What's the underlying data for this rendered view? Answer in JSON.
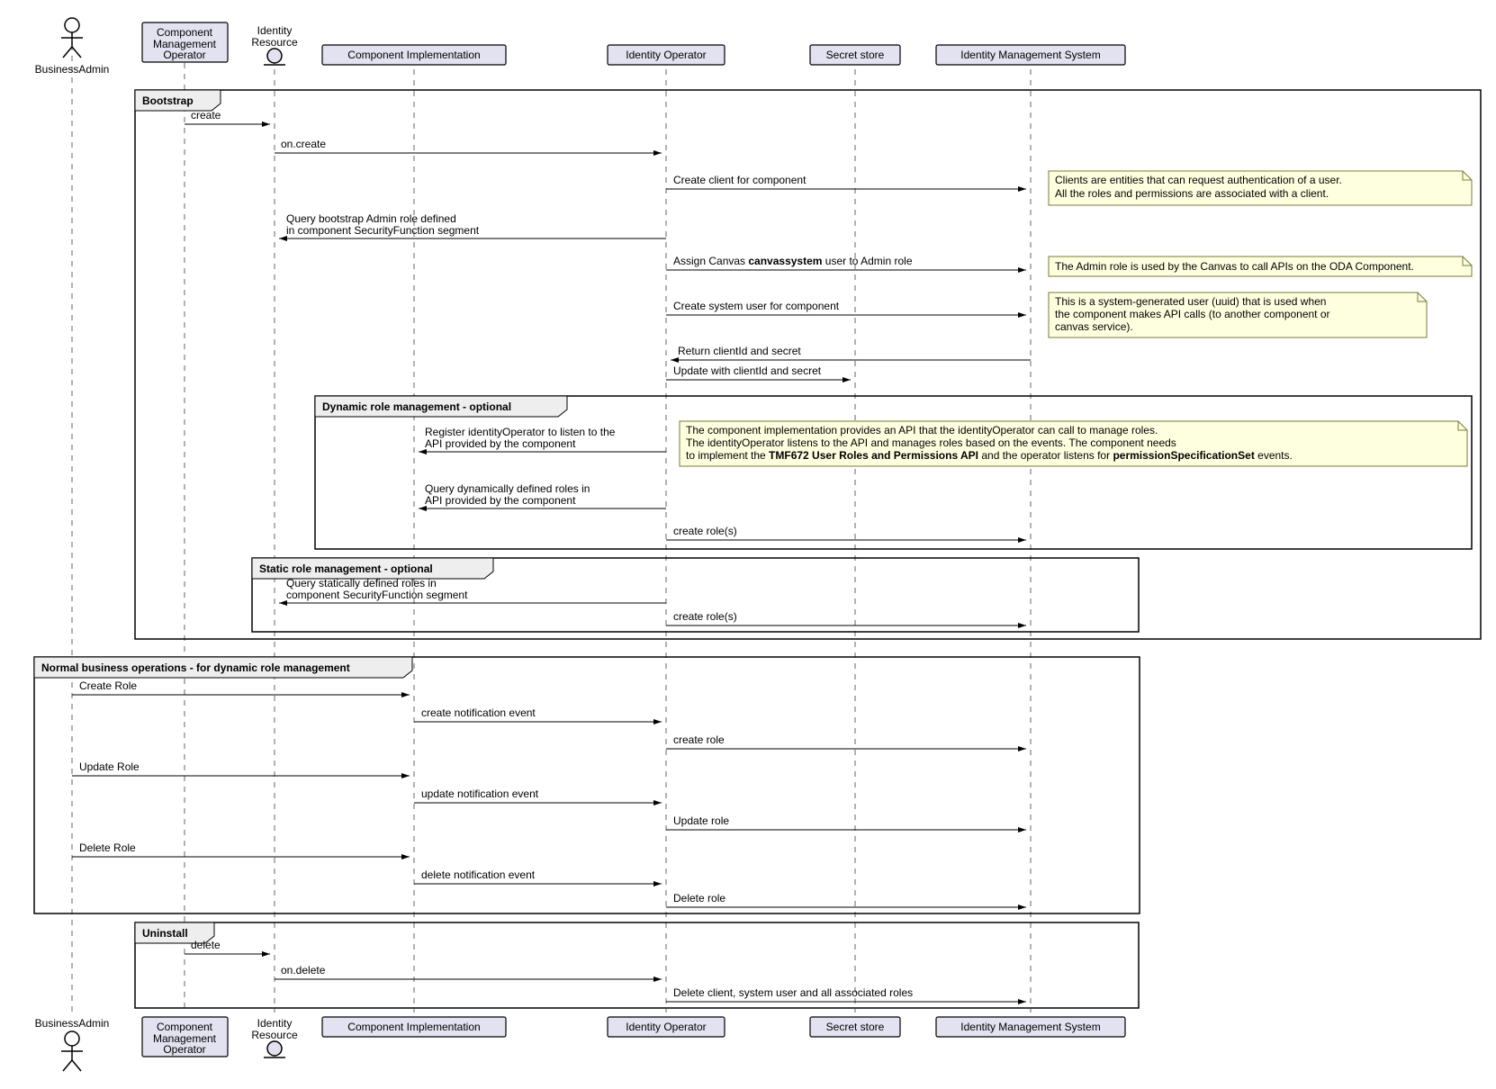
{
  "participants": {
    "businessAdmin": "BusinessAdmin",
    "componentMgmtOp1": "Component",
    "componentMgmtOp2": "Management",
    "componentMgmtOp3": "Operator",
    "identityResource1": "Identity",
    "identityResource2": "Resource",
    "componentImpl": "Component Implementation",
    "identityOperator": "Identity Operator",
    "secretStore": "Secret store",
    "ims": "Identity Management System"
  },
  "groups": {
    "bootstrap": "Bootstrap",
    "dynamicRole": "Dynamic role management - optional",
    "staticRole": "Static role management - optional",
    "normalOps": "Normal business operations - for dynamic role management",
    "uninstall": "Uninstall"
  },
  "messages": {
    "create": "create",
    "onCreate": "on.create",
    "createClient": "Create client for component",
    "queryBootstrap1": "Query bootstrap Admin role defined",
    "queryBootstrap2": "in component SecurityFunction segment",
    "assignCanvas1": "Assign Canvas ",
    "assignCanvas2": "canvassystem",
    "assignCanvas3": " user to Admin role",
    "createSysUser": "Create system user for component",
    "returnClientId": "Return clientId and secret",
    "updateClientId": "Update with clientId and secret",
    "registerListen1": "Register identityOperator to listen to the",
    "registerListen2": "API provided by the component",
    "queryDyn1": "Query dynamically defined roles in",
    "queryDyn2": "API provided by the component",
    "createRoles": "create role(s)",
    "queryStatic1": "Query statically defined roles in",
    "queryStatic2": "component SecurityFunction segment",
    "createRoleMsg": "Create Role",
    "createNotif": "create notification event",
    "createRole": "create role",
    "updateRoleMsg": "Update Role",
    "updateNotif": "update notification event",
    "updateRole": "Update role",
    "deleteRoleMsg": "Delete Role",
    "deleteNotif": "delete notification event",
    "deleteRole": "Delete role",
    "delete": "delete",
    "onDelete": "on.delete",
    "deleteClient": "Delete client, system user and all associated roles"
  },
  "notes": {
    "n1l1": "Clients are entities that can request authentication of a user.",
    "n1l2": "All the roles and permissions are associated with a client.",
    "n2": "The Admin role is used by the Canvas to call APIs on the ODA Component.",
    "n3l1": "This is a system-generated user (uuid) that is used when",
    "n3l2": "the component makes API calls (to another component or",
    "n3l3": "canvas service).",
    "n4l1": "The component implementation provides an API that the identityOperator can call to manage roles.",
    "n4l2": "The identityOperator listens to the API and manages roles based on the events. The component needs",
    "n4l3a": "to implement the ",
    "n4l3b": "TMF672 User Roles and Permissions API",
    "n4l3c": " and the operator listens for ",
    "n4l3d": "permissionSpecificationSet",
    "n4l3e": " events."
  }
}
